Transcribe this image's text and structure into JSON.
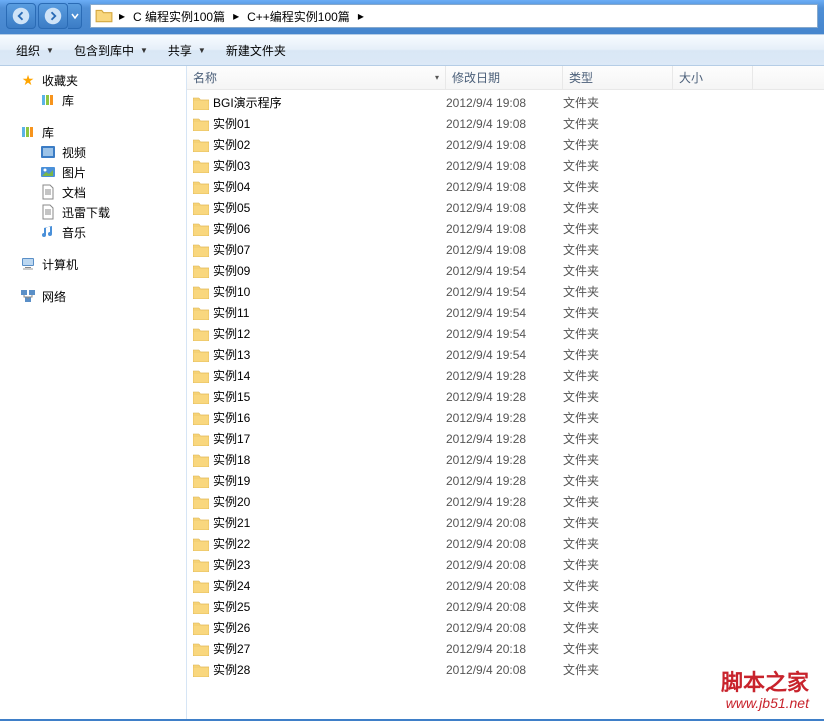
{
  "address": {
    "segments": [
      "C  编程实例100篇",
      "C++编程实例100篇"
    ]
  },
  "toolbar": {
    "organize": "组织",
    "include": "包含到库中",
    "share": "共享",
    "newfolder": "新建文件夹"
  },
  "sidebar": {
    "favorites": "收藏夹",
    "library_top": "库",
    "library": "库",
    "video": "视频",
    "pictures": "图片",
    "documents": "文档",
    "thunder": "迅雷下载",
    "music": "音乐",
    "computer": "计算机",
    "network": "网络"
  },
  "columns": {
    "name": "名称",
    "date": "修改日期",
    "type": "类型",
    "size": "大小"
  },
  "files": [
    {
      "name": "BGI演示程序",
      "date": "2012/9/4 19:08",
      "type": "文件夹"
    },
    {
      "name": "实例01",
      "date": "2012/9/4 19:08",
      "type": "文件夹"
    },
    {
      "name": "实例02",
      "date": "2012/9/4 19:08",
      "type": "文件夹"
    },
    {
      "name": "实例03",
      "date": "2012/9/4 19:08",
      "type": "文件夹"
    },
    {
      "name": "实例04",
      "date": "2012/9/4 19:08",
      "type": "文件夹"
    },
    {
      "name": "实例05",
      "date": "2012/9/4 19:08",
      "type": "文件夹"
    },
    {
      "name": "实例06",
      "date": "2012/9/4 19:08",
      "type": "文件夹"
    },
    {
      "name": "实例07",
      "date": "2012/9/4 19:08",
      "type": "文件夹"
    },
    {
      "name": "实例09",
      "date": "2012/9/4 19:54",
      "type": "文件夹"
    },
    {
      "name": "实例10",
      "date": "2012/9/4 19:54",
      "type": "文件夹"
    },
    {
      "name": "实例11",
      "date": "2012/9/4 19:54",
      "type": "文件夹"
    },
    {
      "name": "实例12",
      "date": "2012/9/4 19:54",
      "type": "文件夹"
    },
    {
      "name": "实例13",
      "date": "2012/9/4 19:54",
      "type": "文件夹"
    },
    {
      "name": "实例14",
      "date": "2012/9/4 19:28",
      "type": "文件夹"
    },
    {
      "name": "实例15",
      "date": "2012/9/4 19:28",
      "type": "文件夹"
    },
    {
      "name": "实例16",
      "date": "2012/9/4 19:28",
      "type": "文件夹"
    },
    {
      "name": "实例17",
      "date": "2012/9/4 19:28",
      "type": "文件夹"
    },
    {
      "name": "实例18",
      "date": "2012/9/4 19:28",
      "type": "文件夹"
    },
    {
      "name": "实例19",
      "date": "2012/9/4 19:28",
      "type": "文件夹"
    },
    {
      "name": "实例20",
      "date": "2012/9/4 19:28",
      "type": "文件夹"
    },
    {
      "name": "实例21",
      "date": "2012/9/4 20:08",
      "type": "文件夹"
    },
    {
      "name": "实例22",
      "date": "2012/9/4 20:08",
      "type": "文件夹"
    },
    {
      "name": "实例23",
      "date": "2012/9/4 20:08",
      "type": "文件夹"
    },
    {
      "name": "实例24",
      "date": "2012/9/4 20:08",
      "type": "文件夹"
    },
    {
      "name": "实例25",
      "date": "2012/9/4 20:08",
      "type": "文件夹"
    },
    {
      "name": "实例26",
      "date": "2012/9/4 20:08",
      "type": "文件夹"
    },
    {
      "name": "实例27",
      "date": "2012/9/4 20:18",
      "type": "文件夹"
    },
    {
      "name": "实例28",
      "date": "2012/9/4 20:08",
      "type": "文件夹"
    }
  ],
  "watermark": {
    "title": "脚本之家",
    "url": "www.jb51.net"
  }
}
